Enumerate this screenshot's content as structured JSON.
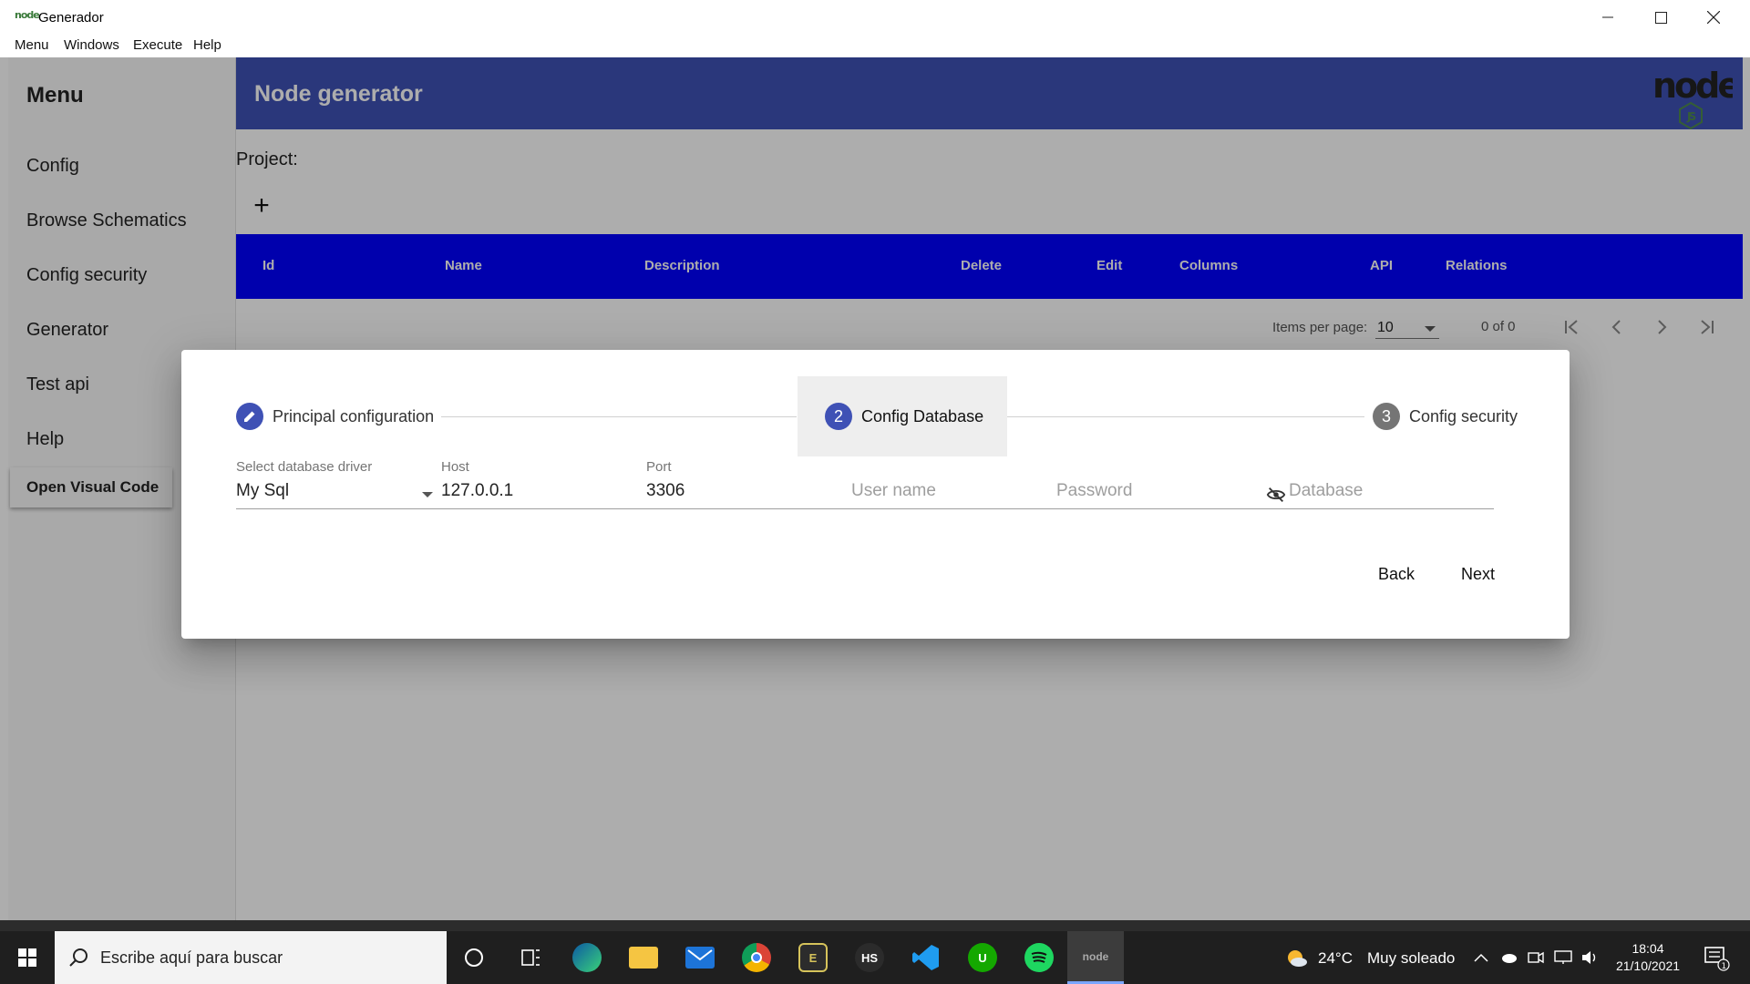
{
  "window": {
    "title": "Generador",
    "app_icon_text": "node"
  },
  "menubar": {
    "items": [
      "Menu",
      "Windows",
      "Execute",
      "Help"
    ]
  },
  "sidebar": {
    "title": "Menu",
    "items": [
      "Config",
      "Browse Schematics",
      "Config security",
      "Generator",
      "Test api",
      "Help"
    ],
    "open_vs_label": "Open Visual Code"
  },
  "header": {
    "title": "Node generator",
    "logo_text": "node"
  },
  "project": {
    "label": "Project:",
    "add_symbol": "+"
  },
  "table": {
    "columns": [
      "Id",
      "Name",
      "Description",
      "Delete",
      "Edit",
      "Columns",
      "API",
      "Relations"
    ],
    "header_color": "#0000ff"
  },
  "paginator": {
    "items_per_page_label": "Items per page:",
    "page_size": "10",
    "range": "0 of 0"
  },
  "dialog": {
    "steps": [
      {
        "number": "1",
        "label": "Principal configuration",
        "state": "edit"
      },
      {
        "number": "2",
        "label": "Config Database",
        "state": "active"
      },
      {
        "number": "3",
        "label": "Config security",
        "state": "pending"
      }
    ],
    "fields": {
      "driver": {
        "label": "Select database driver",
        "value": "My Sql"
      },
      "host": {
        "label": "Host",
        "value": "127.0.0.1"
      },
      "port": {
        "label": "Port",
        "value": "3306"
      },
      "user": {
        "placeholder": "User name"
      },
      "password": {
        "placeholder": "Password"
      },
      "database": {
        "placeholder": "Database"
      }
    },
    "back_label": "Back",
    "next_label": "Next"
  },
  "taskbar": {
    "search_placeholder": "Escribe aquí para buscar",
    "weather": {
      "temp": "24°C",
      "text": "Muy soleado"
    },
    "time": "18:04",
    "date": "21/10/2021",
    "notification_count": "1"
  },
  "colors": {
    "primary": "#3f51b5",
    "table_header": "#0000ff",
    "taskbar": "#1f1f1f"
  }
}
